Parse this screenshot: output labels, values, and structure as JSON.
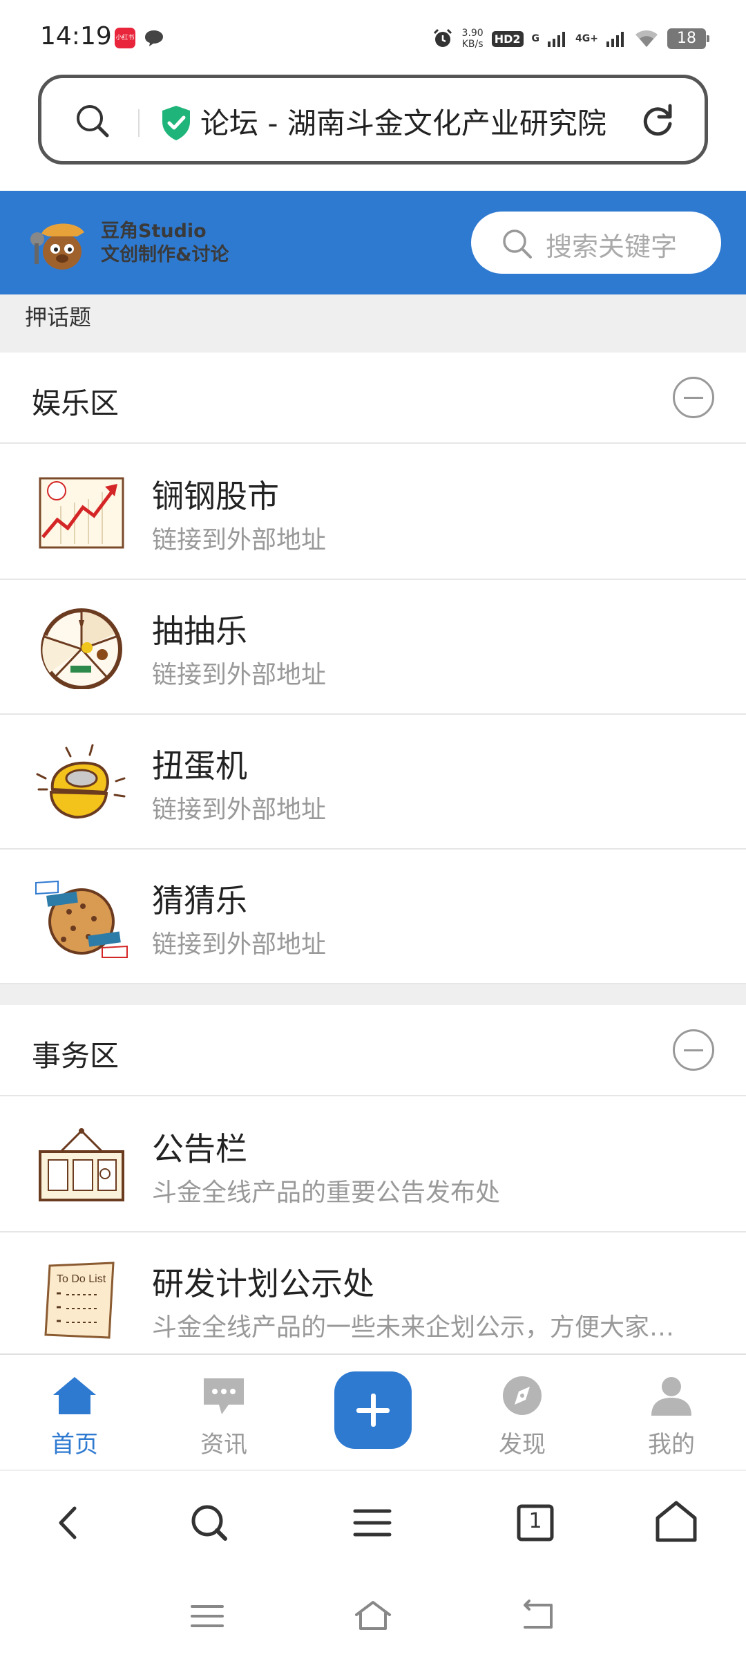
{
  "status_bar": {
    "time": "14:19",
    "app_badge": "小红书",
    "net_speed_value": "3.90",
    "net_speed_unit": "KB/s",
    "hd_label": "HD2",
    "sig1": "G",
    "sig2": "4G+",
    "battery": "18"
  },
  "url_bar": {
    "page_title": "论坛 - 湖南斗金文化产业研究院"
  },
  "site_header": {
    "logo_title": "豆角Studio",
    "logo_subtitle": "文创制作&讨论",
    "search_placeholder": "搜索关键字"
  },
  "subheader": {
    "label": "押话题"
  },
  "sections": [
    {
      "title": "娱乐区",
      "forums": [
        {
          "name": "锎钢股市",
          "desc": "链接到外部地址",
          "icon": "stock-chart-icon"
        },
        {
          "name": "抽抽乐",
          "desc": "链接到外部地址",
          "icon": "prize-wheel-icon"
        },
        {
          "name": "扭蛋机",
          "desc": "链接到外部地址",
          "icon": "gacha-capsule-icon"
        },
        {
          "name": "猜猜乐",
          "desc": "链接到外部地址",
          "icon": "cookie-guess-icon"
        }
      ]
    },
    {
      "title": "事务区",
      "forums": [
        {
          "name": "公告栏",
          "desc": "斗金全线产品的重要公告发布处",
          "icon": "bulletin-board-icon"
        },
        {
          "name": "研发计划公示处",
          "desc": "斗金全线产品的一些未来企划公示，方便大家了解",
          "icon": "todo-list-icon"
        }
      ]
    }
  ],
  "todo_icon_text": "To Do List",
  "tabbar": {
    "home": "首页",
    "news": "资讯",
    "discover": "发现",
    "mine": "我的"
  },
  "browser_toolbar": {
    "tab_count": "1"
  },
  "colors": {
    "brand_blue": "#2f7ad1",
    "shield_green": "#1fb57a"
  }
}
